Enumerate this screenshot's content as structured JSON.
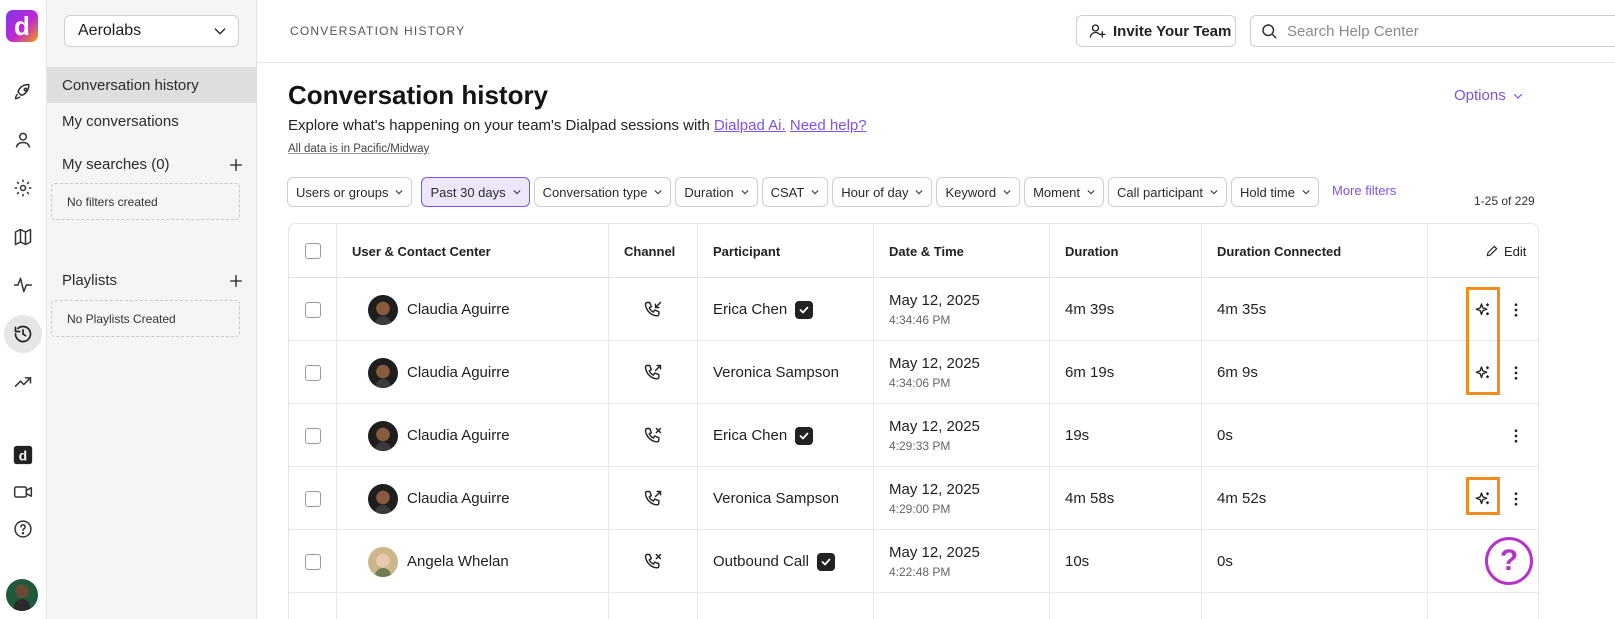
{
  "rail": {
    "logo_letter": "d",
    "icons": [
      "rocket-icon",
      "person-icon",
      "gear-icon",
      "map-icon",
      "activity-icon",
      "history-icon",
      "trending-up-icon",
      "dialpad-app-icon",
      "video-icon",
      "help-circle-icon"
    ],
    "active_icon": "history-icon"
  },
  "sidebar": {
    "org_name": "Aerolabs",
    "items": [
      {
        "label": "Conversation history",
        "selected": true
      },
      {
        "label": "My conversations",
        "selected": false
      }
    ],
    "searches_title": "My searches (0)",
    "searches_empty": "No filters created",
    "playlists_title": "Playlists",
    "playlists_empty": "No Playlists Created"
  },
  "topbar": {
    "breadcrumb": "CONVERSATION HISTORY",
    "invite_label": "Invite Your Team",
    "search_placeholder": "Search Help Center"
  },
  "page": {
    "title": "Conversation history",
    "options_label": "Options",
    "subtitle_text": "Explore what's happening on your team's Dialpad sessions with ",
    "subtitle_link1": "Dialpad Ai.",
    "subtitle_link2": "Need help?",
    "timezone_note": "All data is in Pacific/Midway"
  },
  "filters": {
    "chips": [
      "Users or groups",
      "Past 30 days",
      "Conversation type",
      "Duration",
      "CSAT",
      "Hour of day",
      "Keyword",
      "Moment",
      "Call participant",
      "Hold time"
    ],
    "active_chip": "Past 30 days",
    "more_filters_label": "More filters",
    "result_count": "1-25 of 229"
  },
  "table": {
    "columns": [
      "User & Contact Center",
      "Channel",
      "Participant",
      "Date & Time",
      "Duration",
      "Duration Connected"
    ],
    "edit_label": "Edit",
    "rows": [
      {
        "user": "Claudia Aguirre",
        "avatar": "claudia",
        "channel_icon": "inbound-call-icon",
        "participant": "Erica Chen",
        "verified": true,
        "date": "May 12, 2025",
        "time": "4:34:46 PM",
        "duration": "4m 39s",
        "connected": "4m 35s",
        "ai": true
      },
      {
        "user": "Claudia Aguirre",
        "avatar": "claudia",
        "channel_icon": "outbound-call-icon",
        "participant": "Veronica Sampson",
        "verified": false,
        "date": "May 12, 2025",
        "time": "4:34:06 PM",
        "duration": "6m 19s",
        "connected": "6m 9s",
        "ai": true
      },
      {
        "user": "Claudia Aguirre",
        "avatar": "claudia",
        "channel_icon": "missed-call-icon",
        "participant": "Erica Chen",
        "verified": true,
        "date": "May 12, 2025",
        "time": "4:29:33 PM",
        "duration": "19s",
        "connected": "0s",
        "ai": false
      },
      {
        "user": "Claudia Aguirre",
        "avatar": "claudia",
        "channel_icon": "outbound-call-icon",
        "participant": "Veronica Sampson",
        "verified": false,
        "date": "May 12, 2025",
        "time": "4:29:00 PM",
        "duration": "4m 58s",
        "connected": "4m 52s",
        "ai": true
      },
      {
        "user": "Angela Whelan",
        "avatar": "angela",
        "channel_icon": "missed-call-icon",
        "participant": "Outbound Call",
        "verified": true,
        "date": "May 12, 2025",
        "time": "4:22:48 PM",
        "duration": "10s",
        "connected": "0s",
        "ai": false
      }
    ]
  },
  "help_fab": {
    "glyph": "?"
  },
  "colors": {
    "accent": "#7c52e8",
    "highlight": "#f28c1c",
    "fab": "#b433c8"
  }
}
